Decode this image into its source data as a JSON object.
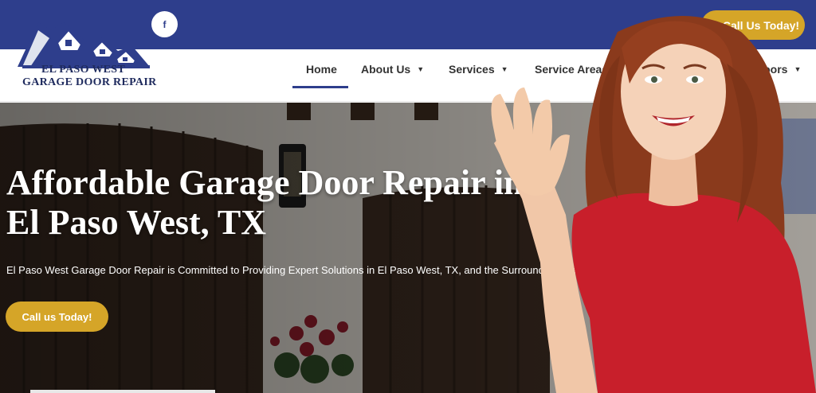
{
  "topbar": {
    "facebook_label": "f",
    "call_label": "Call Us Today!"
  },
  "logo": {
    "line1": "EL PASO WEST",
    "line2": "GARAGE DOOR REPAIR"
  },
  "nav": {
    "items": [
      {
        "label": "Home",
        "active": true,
        "dropdown": false
      },
      {
        "label": "About Us",
        "dropdown": true
      },
      {
        "label": "Services",
        "dropdown": true
      },
      {
        "label": "Service Areas",
        "dropdown": true
      },
      {
        "label": "Doors",
        "dropdown": true
      }
    ]
  },
  "hero": {
    "title_line1": "Affordable Garage Door Repair in",
    "title_line2": "El Paso West, TX",
    "subtitle": "El Paso West Garage Door Repair is Committed to Providing Expert Solutions in El Paso West, TX, and the Surrounding Areas.",
    "cta_label": "Call us Today!"
  },
  "colors": {
    "primary": "#2e3e8c",
    "accent": "#d5a528",
    "shirt": "#c81f2b",
    "hair": "#8a3a1c"
  },
  "icons": [
    "facebook-icon",
    "chevron-down-icon",
    "house-logo-icon"
  ]
}
